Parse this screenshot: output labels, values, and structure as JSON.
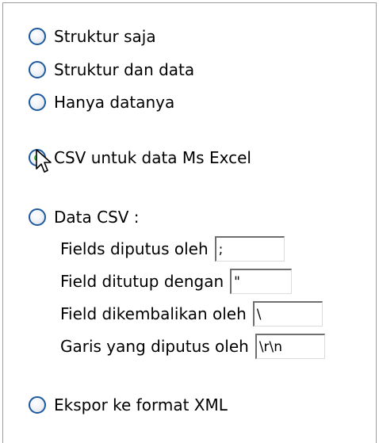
{
  "export_options": {
    "structure_only": "Struktur saja",
    "structure_and_data": "Struktur dan data",
    "data_only": "Hanya datanya",
    "csv_excel": "CSV untuk data Ms Excel",
    "csv_data": "Data CSV :",
    "xml": "Ekspor ke format XML"
  },
  "selected_option": "csv_excel",
  "csv_fields": {
    "fields_terminated": {
      "label": "Fields diputus oleh",
      "value": ";"
    },
    "fields_enclosed": {
      "label": "Field ditutup dengan",
      "value": "\""
    },
    "fields_escaped": {
      "label": "Field dikembalikan oleh",
      "value": "\\"
    },
    "lines_terminated": {
      "label": "Garis yang diputus oleh",
      "value": "\\r\\n"
    }
  },
  "colors": {
    "radio_border": "#1d5a9e",
    "radio_checked": "#21a121",
    "panel_border": "#9c9c9c"
  },
  "icons": {
    "cursor": "mouse-pointer-icon"
  }
}
